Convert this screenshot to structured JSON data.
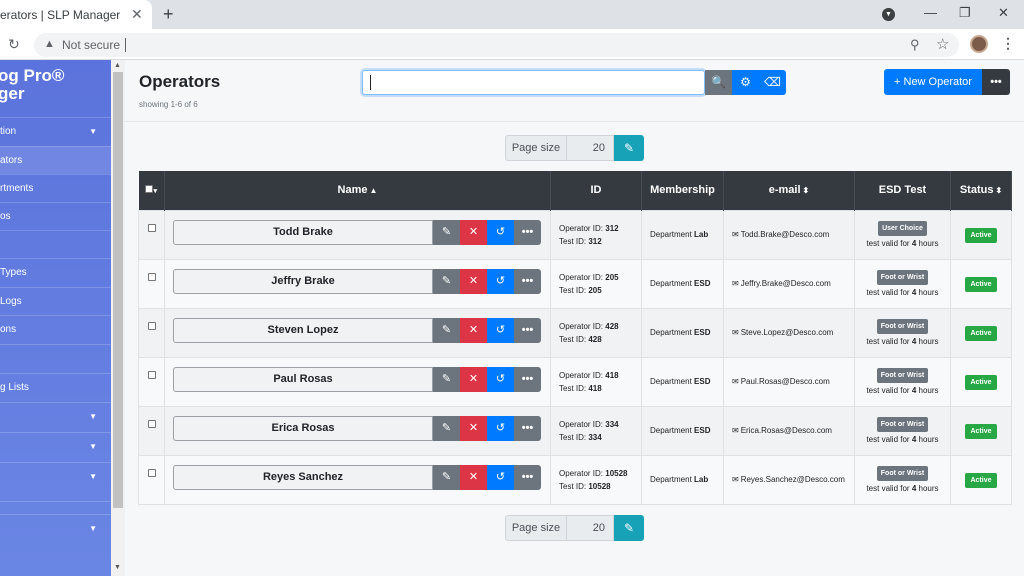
{
  "browser": {
    "tab_title": "erators | SLP Manager",
    "tab_close": "✕",
    "new_tab": "+",
    "reload": "↻",
    "not_secure": "Not secure",
    "warn": "▲",
    "zoom": "⚲",
    "star": "☆",
    "kebab": "⋮",
    "minimize": "—",
    "maximize": "❐",
    "close": "✕",
    "download": "▼"
  },
  "sidebar": {
    "brand_line1": "og Pro®",
    "brand_line2": "ger",
    "items": [
      {
        "label": "tion",
        "caret": "▼"
      },
      {
        "label": "ators",
        "caret": ""
      },
      {
        "label": "rtments",
        "caret": ""
      },
      {
        "label": "os",
        "caret": ""
      },
      {
        "label": "",
        "caret": ""
      },
      {
        "label": " Types",
        "caret": ""
      },
      {
        "label": "Logs",
        "caret": ""
      },
      {
        "label": "ons",
        "caret": ""
      },
      {
        "label": "",
        "caret": ""
      },
      {
        "label": "g Lists",
        "caret": ""
      },
      {
        "label": "",
        "caret": "▼"
      },
      {
        "label": "",
        "caret": "▼"
      },
      {
        "label": "",
        "caret": "▼"
      },
      {
        "label": "",
        "caret": ""
      },
      {
        "label": "",
        "caret": "▼"
      }
    ]
  },
  "header": {
    "title": "Operators",
    "showing": "showing 1-6 of 6",
    "search_value": "",
    "search_icon": "🔍",
    "gear_icon": "⚙",
    "eraser_icon": "⌫",
    "new_operator": "+ New Operator",
    "more": "•••"
  },
  "pager": {
    "label": "Page size",
    "value": "20",
    "apply_icon": "✎"
  },
  "table": {
    "columns": {
      "select": "▾",
      "name": "Name",
      "name_sort": "▲",
      "id": "ID",
      "membership": "Membership",
      "email": "e-mail",
      "email_sort": "⬍",
      "esd": "ESD Test",
      "status": "Status",
      "status_sort": "⬍"
    },
    "actions": {
      "edit": "✎",
      "delete": "✕",
      "history": "↺",
      "more": "•••"
    },
    "operator_id_label": "Operator ID:",
    "test_id_label": "Test ID:",
    "department_label": "Department",
    "valid_prefix": "test valid for",
    "valid_suffix": "hours",
    "email_icon": "✉",
    "rows": [
      {
        "name": "Todd Brake",
        "operator_id": "312",
        "test_id": "312",
        "department": "Lab",
        "email": "Todd.Brake@Desco.com",
        "esd": "User Choice",
        "hours": "4",
        "status": "Active"
      },
      {
        "name": "Jeffry Brake",
        "operator_id": "205",
        "test_id": "205",
        "department": "ESD",
        "email": "Jeffry.Brake@Desco.com",
        "esd": "Foot or Wrist",
        "hours": "4",
        "status": "Active"
      },
      {
        "name": "Steven Lopez",
        "operator_id": "428",
        "test_id": "428",
        "department": "ESD",
        "email": "Steve.Lopez@Desco.com",
        "esd": "Foot or Wrist",
        "hours": "4",
        "status": "Active"
      },
      {
        "name": "Paul Rosas",
        "operator_id": "418",
        "test_id": "418",
        "department": "ESD",
        "email": "Paul.Rosas@Desco.com",
        "esd": "Foot or Wrist",
        "hours": "4",
        "status": "Active"
      },
      {
        "name": "Erica Rosas",
        "operator_id": "334",
        "test_id": "334",
        "department": "ESD",
        "email": "Erica.Rosas@Desco.com",
        "esd": "Foot or Wrist",
        "hours": "4",
        "status": "Active"
      },
      {
        "name": "Reyes Sanchez",
        "operator_id": "10528",
        "test_id": "10528",
        "department": "Lab",
        "email": "Reyes.Sanchez@Desco.com",
        "esd": "Foot or Wrist",
        "hours": "4",
        "status": "Active"
      }
    ]
  }
}
